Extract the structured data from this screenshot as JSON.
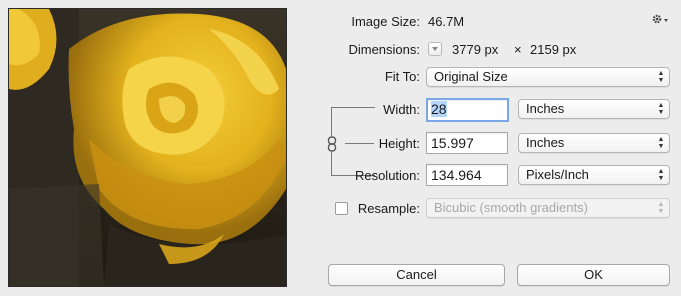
{
  "image_size": {
    "label": "Image Size:",
    "value": "46.7M"
  },
  "dimensions": {
    "label": "Dimensions:",
    "width": "3779 px",
    "times": "×",
    "height": "2159 px"
  },
  "fit_to": {
    "label": "Fit To:",
    "value": "Original Size"
  },
  "width": {
    "label": "Width:",
    "value": "28",
    "unit": "Inches"
  },
  "height": {
    "label": "Height:",
    "value": "15.997",
    "unit": "Inches"
  },
  "resolution": {
    "label": "Resolution:",
    "value": "134.964",
    "unit": "Pixels/Inch"
  },
  "resample": {
    "label": "Resample:",
    "checked": false,
    "value": "Bicubic (smooth gradients)"
  },
  "buttons": {
    "cancel": "Cancel",
    "ok": "OK"
  },
  "colors": {
    "focus_ring": "#7aa7e6",
    "selection": "#b5d5ff",
    "rose": "#e8b820"
  },
  "icons": {
    "settings": "gear-icon",
    "dimensions_menu": "dropdown-arrow-icon",
    "constrain": "chain-link-icon"
  }
}
